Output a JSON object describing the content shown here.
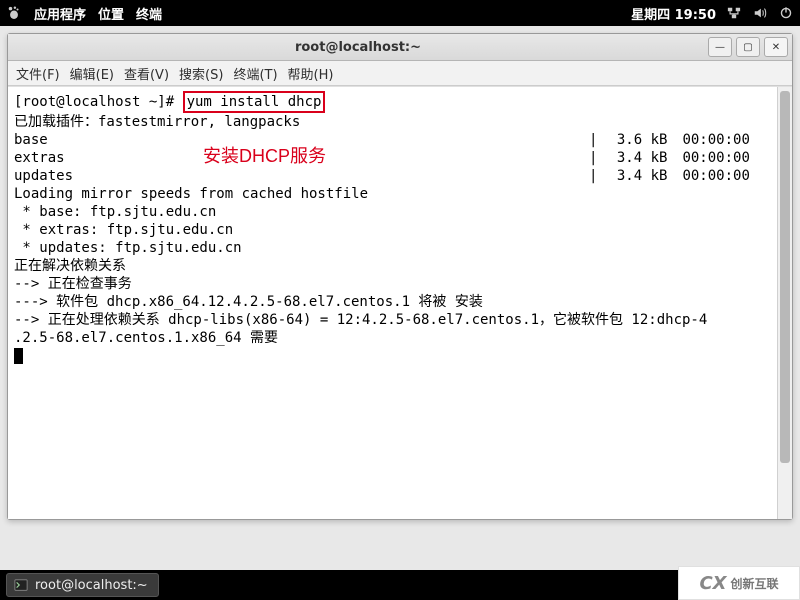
{
  "panel": {
    "apps": "应用程序",
    "places": "位置",
    "terminal": "终端",
    "datetime": "星期四 19:50"
  },
  "window": {
    "title": "root@localhost:~"
  },
  "menubar": {
    "file": "文件(F)",
    "edit": "编辑(E)",
    "view": "查看(V)",
    "search": "搜索(S)",
    "terminal_menu": "终端(T)",
    "help": "帮助(H)"
  },
  "terminal": {
    "prompt": "[root@localhost ~]# ",
    "command": "yum install dhcp",
    "plugins": "已加载插件：fastestmirror, langpacks",
    "repos": [
      {
        "name": "base",
        "size": "3.6 kB",
        "time": "00:00:00"
      },
      {
        "name": "extras",
        "size": "3.4 kB",
        "time": "00:00:00"
      },
      {
        "name": "updates",
        "size": "3.4 kB",
        "time": "00:00:00"
      }
    ],
    "loading": "Loading mirror speeds from cached hostfile",
    "mirrors": [
      " * base: ftp.sjtu.edu.cn",
      " * extras: ftp.sjtu.edu.cn",
      " * updates: ftp.sjtu.edu.cn"
    ],
    "resolving": "正在解决依赖关系",
    "checking": "--> 正在检查事务",
    "pkg_install": "---> 软件包 dhcp.x86_64.12.4.2.5-68.el7.centos.1 将被 安装",
    "dep_line1": "--> 正在处理依赖关系 dhcp-libs(x86-64) = 12:4.2.5-68.el7.centos.1，它被软件包 12:dhcp-4",
    "dep_line2": ".2.5-68.el7.centos.1.x86_64 需要",
    "annotation": "安装DHCP服务"
  },
  "taskbar": {
    "item": "root@localhost:~"
  },
  "watermark": {
    "text": "创新互联",
    "prefix": "CX"
  }
}
